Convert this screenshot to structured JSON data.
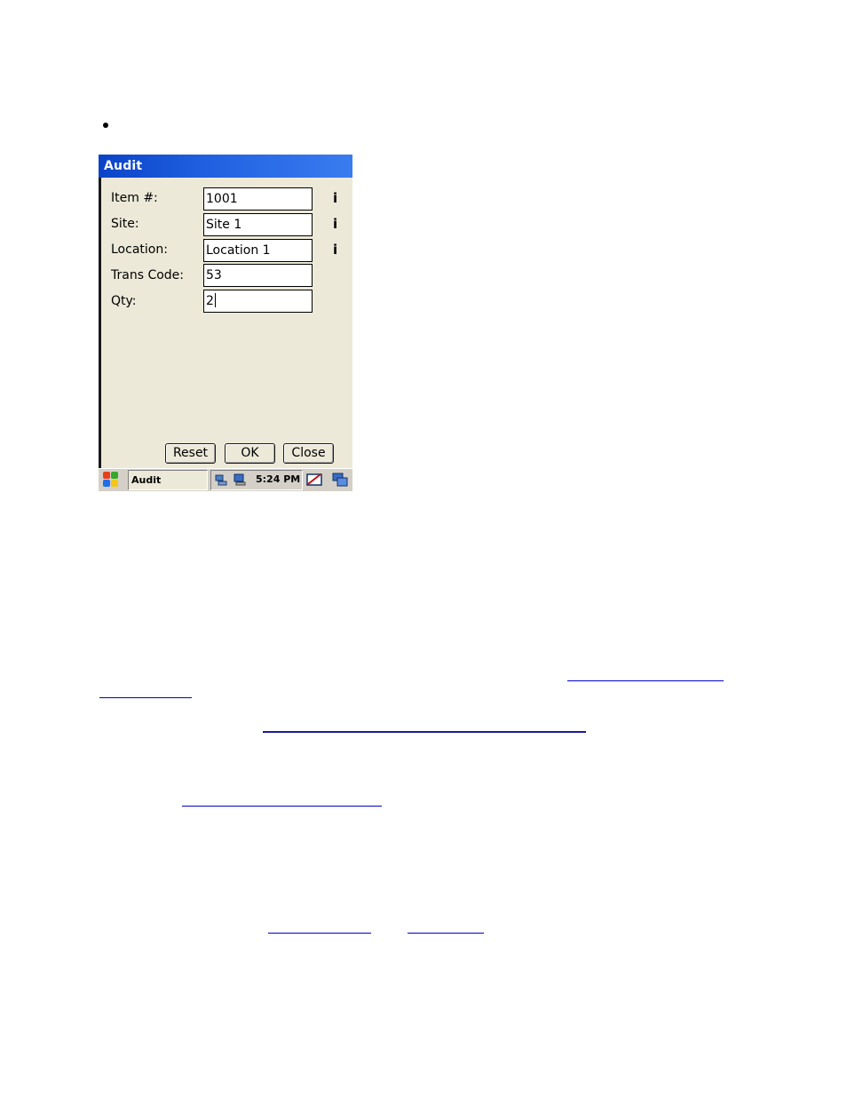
{
  "window": {
    "title": "Audit"
  },
  "form": {
    "fields": [
      {
        "label": "Item #:",
        "value": "1001",
        "info": "i"
      },
      {
        "label": "Site:",
        "value": "Site 1",
        "info": "i"
      },
      {
        "label": "Location:",
        "value": "Location 1",
        "info": "i"
      },
      {
        "label": "Trans Code:",
        "value": "53"
      },
      {
        "label": "Qty:",
        "value": "2"
      }
    ]
  },
  "buttons": {
    "reset": "Reset",
    "ok": "OK",
    "close": "Close"
  },
  "taskbar": {
    "task": "Audit",
    "clock": "5:24 PM"
  },
  "colors": {
    "titlebar": "#0a43c8",
    "window_bg": "#ece9d8",
    "link": "#0000cc"
  },
  "icons": [
    "windows-start-icon",
    "network-icon",
    "monitor-icon",
    "keyboard-icon",
    "desktop-icon",
    "info-icon"
  ]
}
